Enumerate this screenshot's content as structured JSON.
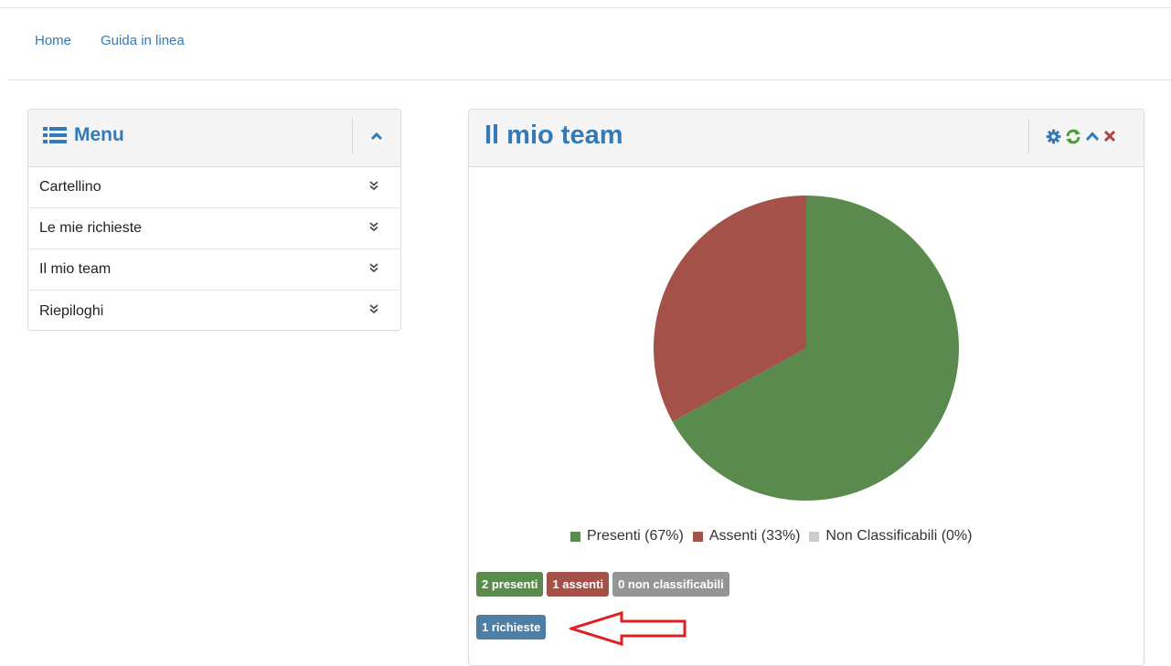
{
  "nav": {
    "home": "Home",
    "help": "Guida in linea"
  },
  "menu": {
    "title": "Menu",
    "items": [
      {
        "label": "Cartellino"
      },
      {
        "label": "Le mie richieste"
      },
      {
        "label": "Il mio team"
      },
      {
        "label": "Riepiloghi"
      }
    ]
  },
  "team": {
    "title": "Il mio team",
    "icons": [
      "gear-icon",
      "refresh-icon",
      "chevron-up-icon",
      "close-icon"
    ]
  },
  "chart_data": {
    "type": "pie",
    "slices": [
      {
        "label": "Presenti (67%)",
        "value": 67,
        "color": "#5a8a4e"
      },
      {
        "label": "Assenti (33%)",
        "value": 33,
        "color": "#a4514a"
      },
      {
        "label": "Non Classificabili (0%)",
        "value": 0,
        "color": "#cccccc"
      }
    ],
    "legend": "bottom"
  },
  "badges": {
    "presenti": "2 presenti",
    "assenti": "1 assenti",
    "non_classificabili": "0 non classificabili",
    "richieste": "1 richieste"
  },
  "colors": {
    "accent": "#337ab7",
    "presenti": "#5a8a4e",
    "assenti": "#a4514a",
    "non_classificabili": "#959595",
    "richieste": "#4f7ea5",
    "arrow": "#e02020",
    "close": "#b0413e"
  }
}
